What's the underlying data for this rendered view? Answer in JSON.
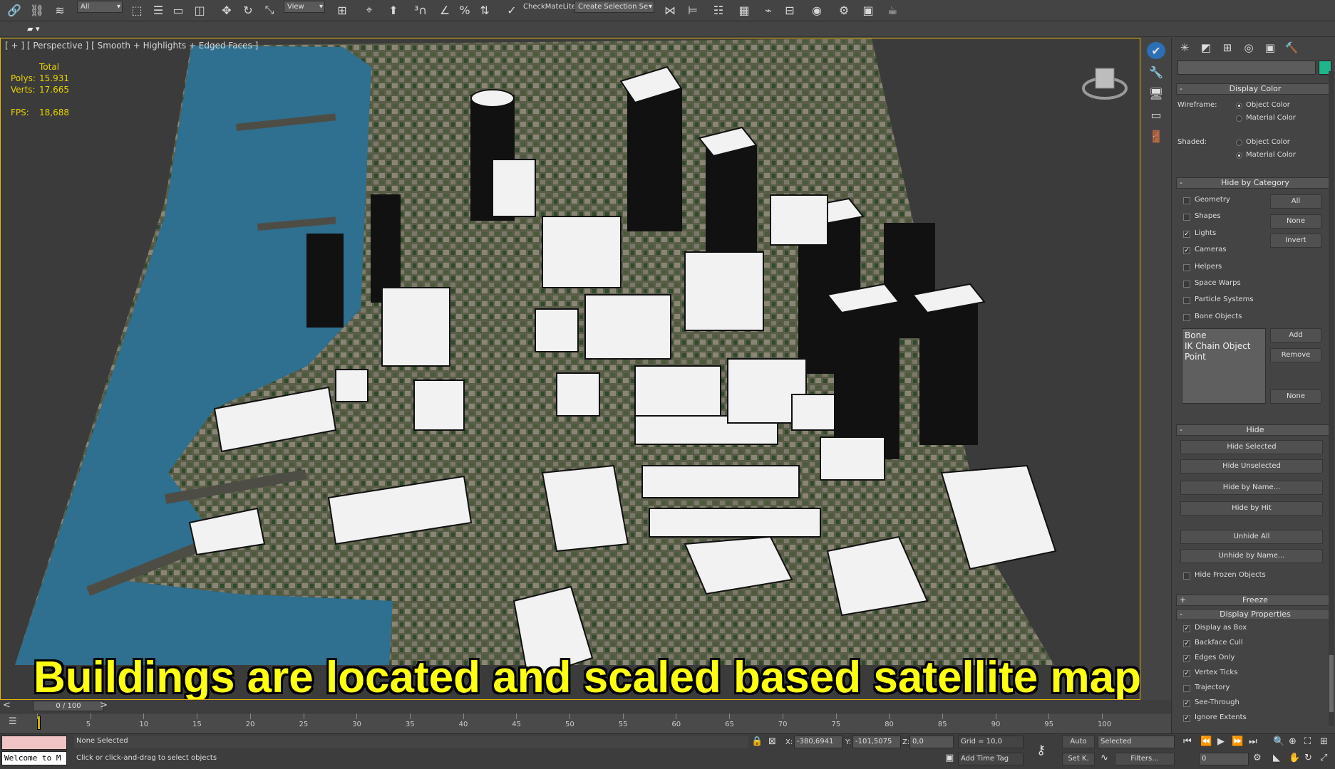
{
  "toolbar": {
    "selection_filter": "All",
    "ref_coord": "View",
    "checkmate_label": "CheckMateLite",
    "named_selection": "Create Selection Se"
  },
  "viewport": {
    "label": "[ + ] [ Perspective ] [ Smooth + Highlights + Edged Faces ]",
    "stats": {
      "total_label": "Total",
      "polys_label": "Polys:",
      "polys_value": "15.931",
      "verts_label": "Verts:",
      "verts_value": "17.665",
      "fps_label": "FPS:",
      "fps_value": "18,688"
    },
    "caption": "Buildings are located and scaled based satellite map!"
  },
  "panel": {
    "display_color": {
      "title": "Display Color",
      "wireframe_label": "Wireframe:",
      "shaded_label": "Shaded:",
      "object_color": "Object Color",
      "material_color": "Material Color",
      "wireframe_selected": "Object Color",
      "shaded_selected": "Material Color"
    },
    "hide_by_category": {
      "title": "Hide by Category",
      "items": [
        {
          "label": "Geometry",
          "checked": false
        },
        {
          "label": "Shapes",
          "checked": false
        },
        {
          "label": "Lights",
          "checked": true
        },
        {
          "label": "Cameras",
          "checked": true
        },
        {
          "label": "Helpers",
          "checked": false
        },
        {
          "label": "Space Warps",
          "checked": false
        },
        {
          "label": "Particle Systems",
          "checked": false
        },
        {
          "label": "Bone Objects",
          "checked": false
        }
      ],
      "btn_all": "All",
      "btn_none": "None",
      "btn_invert": "Invert",
      "list": [
        "Bone",
        "IK Chain Object",
        "Point"
      ],
      "btn_add": "Add",
      "btn_remove": "Remove",
      "btn_none2": "None"
    },
    "hide": {
      "title": "Hide",
      "hide_selected": "Hide Selected",
      "hide_unselected": "Hide Unselected",
      "hide_by_name": "Hide by Name...",
      "hide_by_hit": "Hide by Hit",
      "unhide_all": "Unhide All",
      "unhide_by_name": "Unhide by Name...",
      "hide_frozen": "Hide Frozen Objects"
    },
    "freeze": {
      "title": "Freeze"
    },
    "display_properties": {
      "title": "Display Properties",
      "items": [
        {
          "label": "Display as Box",
          "checked": true
        },
        {
          "label": "Backface Cull",
          "checked": true
        },
        {
          "label": "Edges Only",
          "checked": true
        },
        {
          "label": "Vertex Ticks",
          "checked": true
        },
        {
          "label": "Trajectory",
          "checked": false
        },
        {
          "label": "See-Through",
          "checked": true
        },
        {
          "label": "Ignore Extents",
          "checked": true
        }
      ]
    }
  },
  "timeline": {
    "frame_display": "0 / 100",
    "ticks": [
      "0",
      "5",
      "10",
      "15",
      "20",
      "25",
      "30",
      "35",
      "40",
      "45",
      "50",
      "55",
      "60",
      "65",
      "70",
      "75",
      "80",
      "85",
      "90",
      "95",
      "100"
    ]
  },
  "status": {
    "welcome": "Welcome to M",
    "selection": "None Selected",
    "prompt": "Click or click-and-drag to select objects",
    "x_label": "X:",
    "x_value": "-380,6941",
    "y_label": "Y:",
    "y_value": "-101,5075",
    "z_label": "Z:",
    "z_value": "0,0",
    "grid": "Grid = 10,0",
    "add_time_tag": "Add Time Tag",
    "auto_key": "Auto",
    "set_key": "Set K.",
    "key_mode": "Selected",
    "filters": "Filters...",
    "frame": "0"
  }
}
